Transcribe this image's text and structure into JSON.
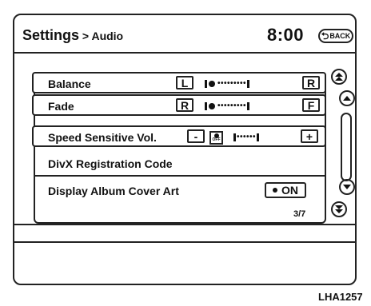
{
  "header": {
    "title": "Settings",
    "separator": " > ",
    "section": "Audio",
    "time": "8:00",
    "back_label": "BACK"
  },
  "rows": [
    {
      "label": "Balance",
      "left_symbol": "L",
      "right_symbol": "R",
      "level": 0.0
    },
    {
      "label": "Fade",
      "left_symbol": "R",
      "right_symbol": "F",
      "level": 0.0
    },
    {
      "label": "Speed Sensitive Vol.",
      "minus": "-",
      "plus": "+",
      "off_label": "OFF"
    },
    {
      "label": "DivX Registration Code"
    },
    {
      "label": "Display Album Cover Art",
      "toggle_value": "ON"
    }
  ],
  "page_indicator": "3/7",
  "figure_id": "LHA1257",
  "icons": {
    "back": "back-arrow-icon",
    "scroll_top": "double-up-arrow-icon",
    "scroll_up": "up-arrow-icon",
    "scroll_down": "down-arrow-icon",
    "scroll_bottom": "double-down-arrow-icon"
  }
}
